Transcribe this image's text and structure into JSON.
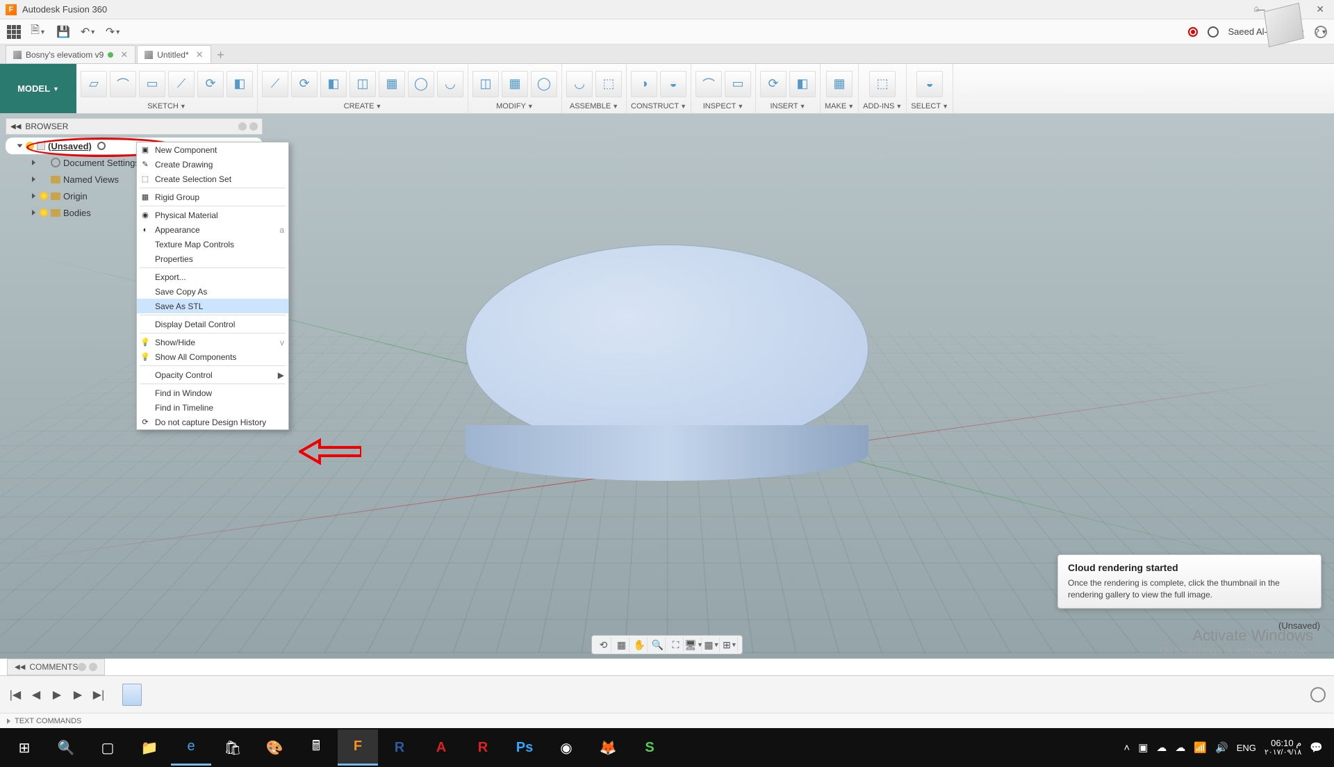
{
  "app": {
    "title": "Autodesk Fusion 360"
  },
  "user": {
    "name": "Saeed Al-Hamza"
  },
  "tabs": [
    {
      "label": "Bosny's elevatiom v9",
      "active": false,
      "unsaved": false
    },
    {
      "label": "Untitled*",
      "active": true,
      "unsaved": true
    }
  ],
  "workspace": {
    "label": "MODEL"
  },
  "ribbon": {
    "groups": [
      {
        "label": "SKETCH",
        "icons": 6
      },
      {
        "label": "CREATE",
        "icons": 7
      },
      {
        "label": "MODIFY",
        "icons": 3
      },
      {
        "label": "ASSEMBLE",
        "icons": 2
      },
      {
        "label": "CONSTRUCT",
        "icons": 2
      },
      {
        "label": "INSPECT",
        "icons": 2
      },
      {
        "label": "INSERT",
        "icons": 2
      },
      {
        "label": "MAKE",
        "icons": 1
      },
      {
        "label": "ADD-INS",
        "icons": 1
      },
      {
        "label": "SELECT",
        "icons": 1
      }
    ]
  },
  "browser": {
    "title": "BROWSER",
    "root": "(Unsaved)",
    "nodes": [
      {
        "label": "Document Settings",
        "icon": "gear"
      },
      {
        "label": "Named Views",
        "icon": "folder"
      },
      {
        "label": "Origin",
        "icon": "folder",
        "bulb": true
      },
      {
        "label": "Bodies",
        "icon": "folder",
        "bulb": true
      }
    ]
  },
  "context_menu": {
    "items": [
      {
        "label": "New Component",
        "icon": "cube"
      },
      {
        "label": "Create Drawing",
        "icon": "draw"
      },
      {
        "label": "Create Selection Set",
        "icon": "sel"
      },
      {
        "sep": true
      },
      {
        "label": "Rigid Group",
        "icon": "rigid"
      },
      {
        "sep": true
      },
      {
        "label": "Physical Material",
        "icon": "mat"
      },
      {
        "label": "Appearance",
        "icon": "app",
        "shortcut": "a"
      },
      {
        "label": "Texture Map Controls"
      },
      {
        "label": "Properties"
      },
      {
        "sep": true
      },
      {
        "label": "Export..."
      },
      {
        "label": "Save Copy As"
      },
      {
        "label": "Save As STL",
        "highlight": true
      },
      {
        "sep": true
      },
      {
        "label": "Display Detail Control"
      },
      {
        "sep": true
      },
      {
        "label": "Show/Hide",
        "icon": "bulb",
        "shortcut": "v"
      },
      {
        "label": "Show All Components",
        "icon": "bulb"
      },
      {
        "sep": true
      },
      {
        "label": "Opacity Control",
        "submenu": true
      },
      {
        "sep": true
      },
      {
        "label": "Find in Window"
      },
      {
        "label": "Find in Timeline"
      },
      {
        "label": "Do not capture Design History",
        "icon": "hist"
      }
    ]
  },
  "notification": {
    "title": "Cloud rendering started",
    "body": "Once the rendering is complete, click the thumbnail in the rendering gallery to view the full image."
  },
  "watermark": {
    "line1": "Activate Windows",
    "line2": "Go to Settings to activate Windows."
  },
  "status_unsaved": "(Unsaved)",
  "comments": {
    "title": "COMMENTS"
  },
  "textcmd": {
    "label": "TEXT COMMANDS"
  },
  "taskbar": {
    "tray": {
      "lang": "ENG",
      "time": "06:10 م",
      "date": "٢٠١٧/٠٩/١٨"
    }
  }
}
